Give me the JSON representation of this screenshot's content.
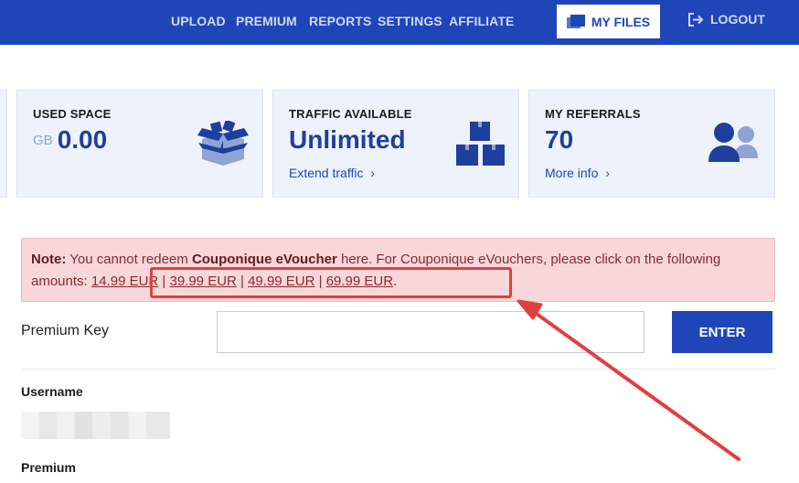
{
  "nav": {
    "items": [
      "UPLOAD",
      "PREMIUM",
      "REPORTS",
      "SETTINGS",
      "AFFILIATE"
    ],
    "my_files": "MY FILES",
    "logout": "LOGOUT"
  },
  "cards": {
    "used_space": {
      "title": "USED SPACE",
      "unit": "GB",
      "value": "0.00",
      "icon": "open-box-icon"
    },
    "traffic": {
      "title": "TRAFFIC AVAILABLE",
      "value": "Unlimited",
      "link": "Extend traffic",
      "icon": "stacked-boxes-icon"
    },
    "referrals": {
      "title": "MY REFERRALS",
      "value": "70",
      "link": "More info",
      "icon": "users-icon"
    }
  },
  "note": {
    "label": "Note:",
    "text1": " You cannot redeem ",
    "product": "Couponique eVoucher",
    "text2": " here. For Couponique eVouchers, please click on the following amounts: ",
    "amounts": [
      "14.99 EUR",
      "39.99 EUR",
      "49.99 EUR",
      "69.99 EUR"
    ],
    "separator": " | ",
    "end": "."
  },
  "premium_key": {
    "label": "Premium Key",
    "value": "",
    "button": "ENTER"
  },
  "account": {
    "username_label": "Username",
    "premium_label": "Premium"
  },
  "colors": {
    "brand": "#1f46b8",
    "note_bg": "#f8d7da",
    "highlight": "#e04040"
  }
}
